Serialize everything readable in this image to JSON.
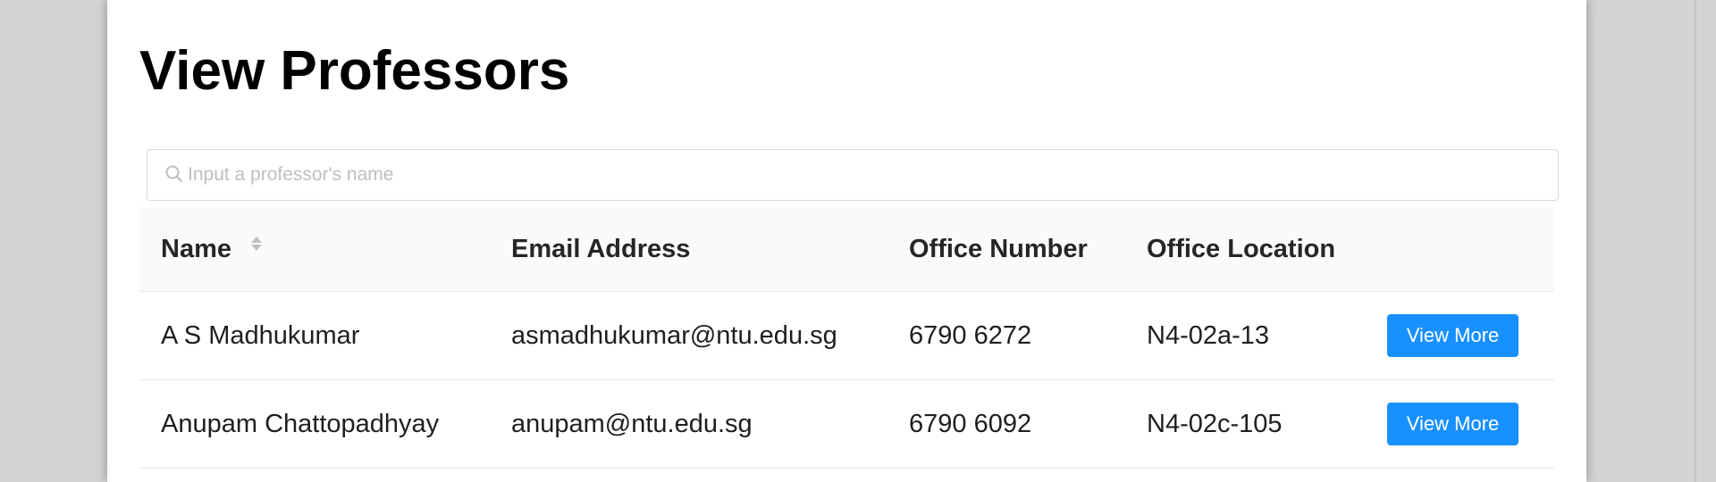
{
  "page": {
    "title": "View Professors"
  },
  "search": {
    "placeholder": "Input a professor's name",
    "value": ""
  },
  "table": {
    "columns": {
      "name": "Name",
      "email": "Email Address",
      "office_number": "Office Number",
      "office_location": "Office Location"
    },
    "rows": [
      {
        "name": "A S Madhukumar",
        "email": "asmadhukumar@ntu.edu.sg",
        "office_number": "6790 6272",
        "office_location": "N4-02a-13",
        "action_label": "View More"
      },
      {
        "name": "Anupam Chattopadhyay",
        "email": "anupam@ntu.edu.sg",
        "office_number": "6790 6092",
        "office_location": "N4-02c-105",
        "action_label": "View More"
      }
    ]
  },
  "icons": {
    "search": "search-icon",
    "sort": "sort-icon"
  },
  "colors": {
    "primary_button": "#1890ff",
    "header_background": "#fafafa",
    "page_background": "#d4d4d4"
  }
}
